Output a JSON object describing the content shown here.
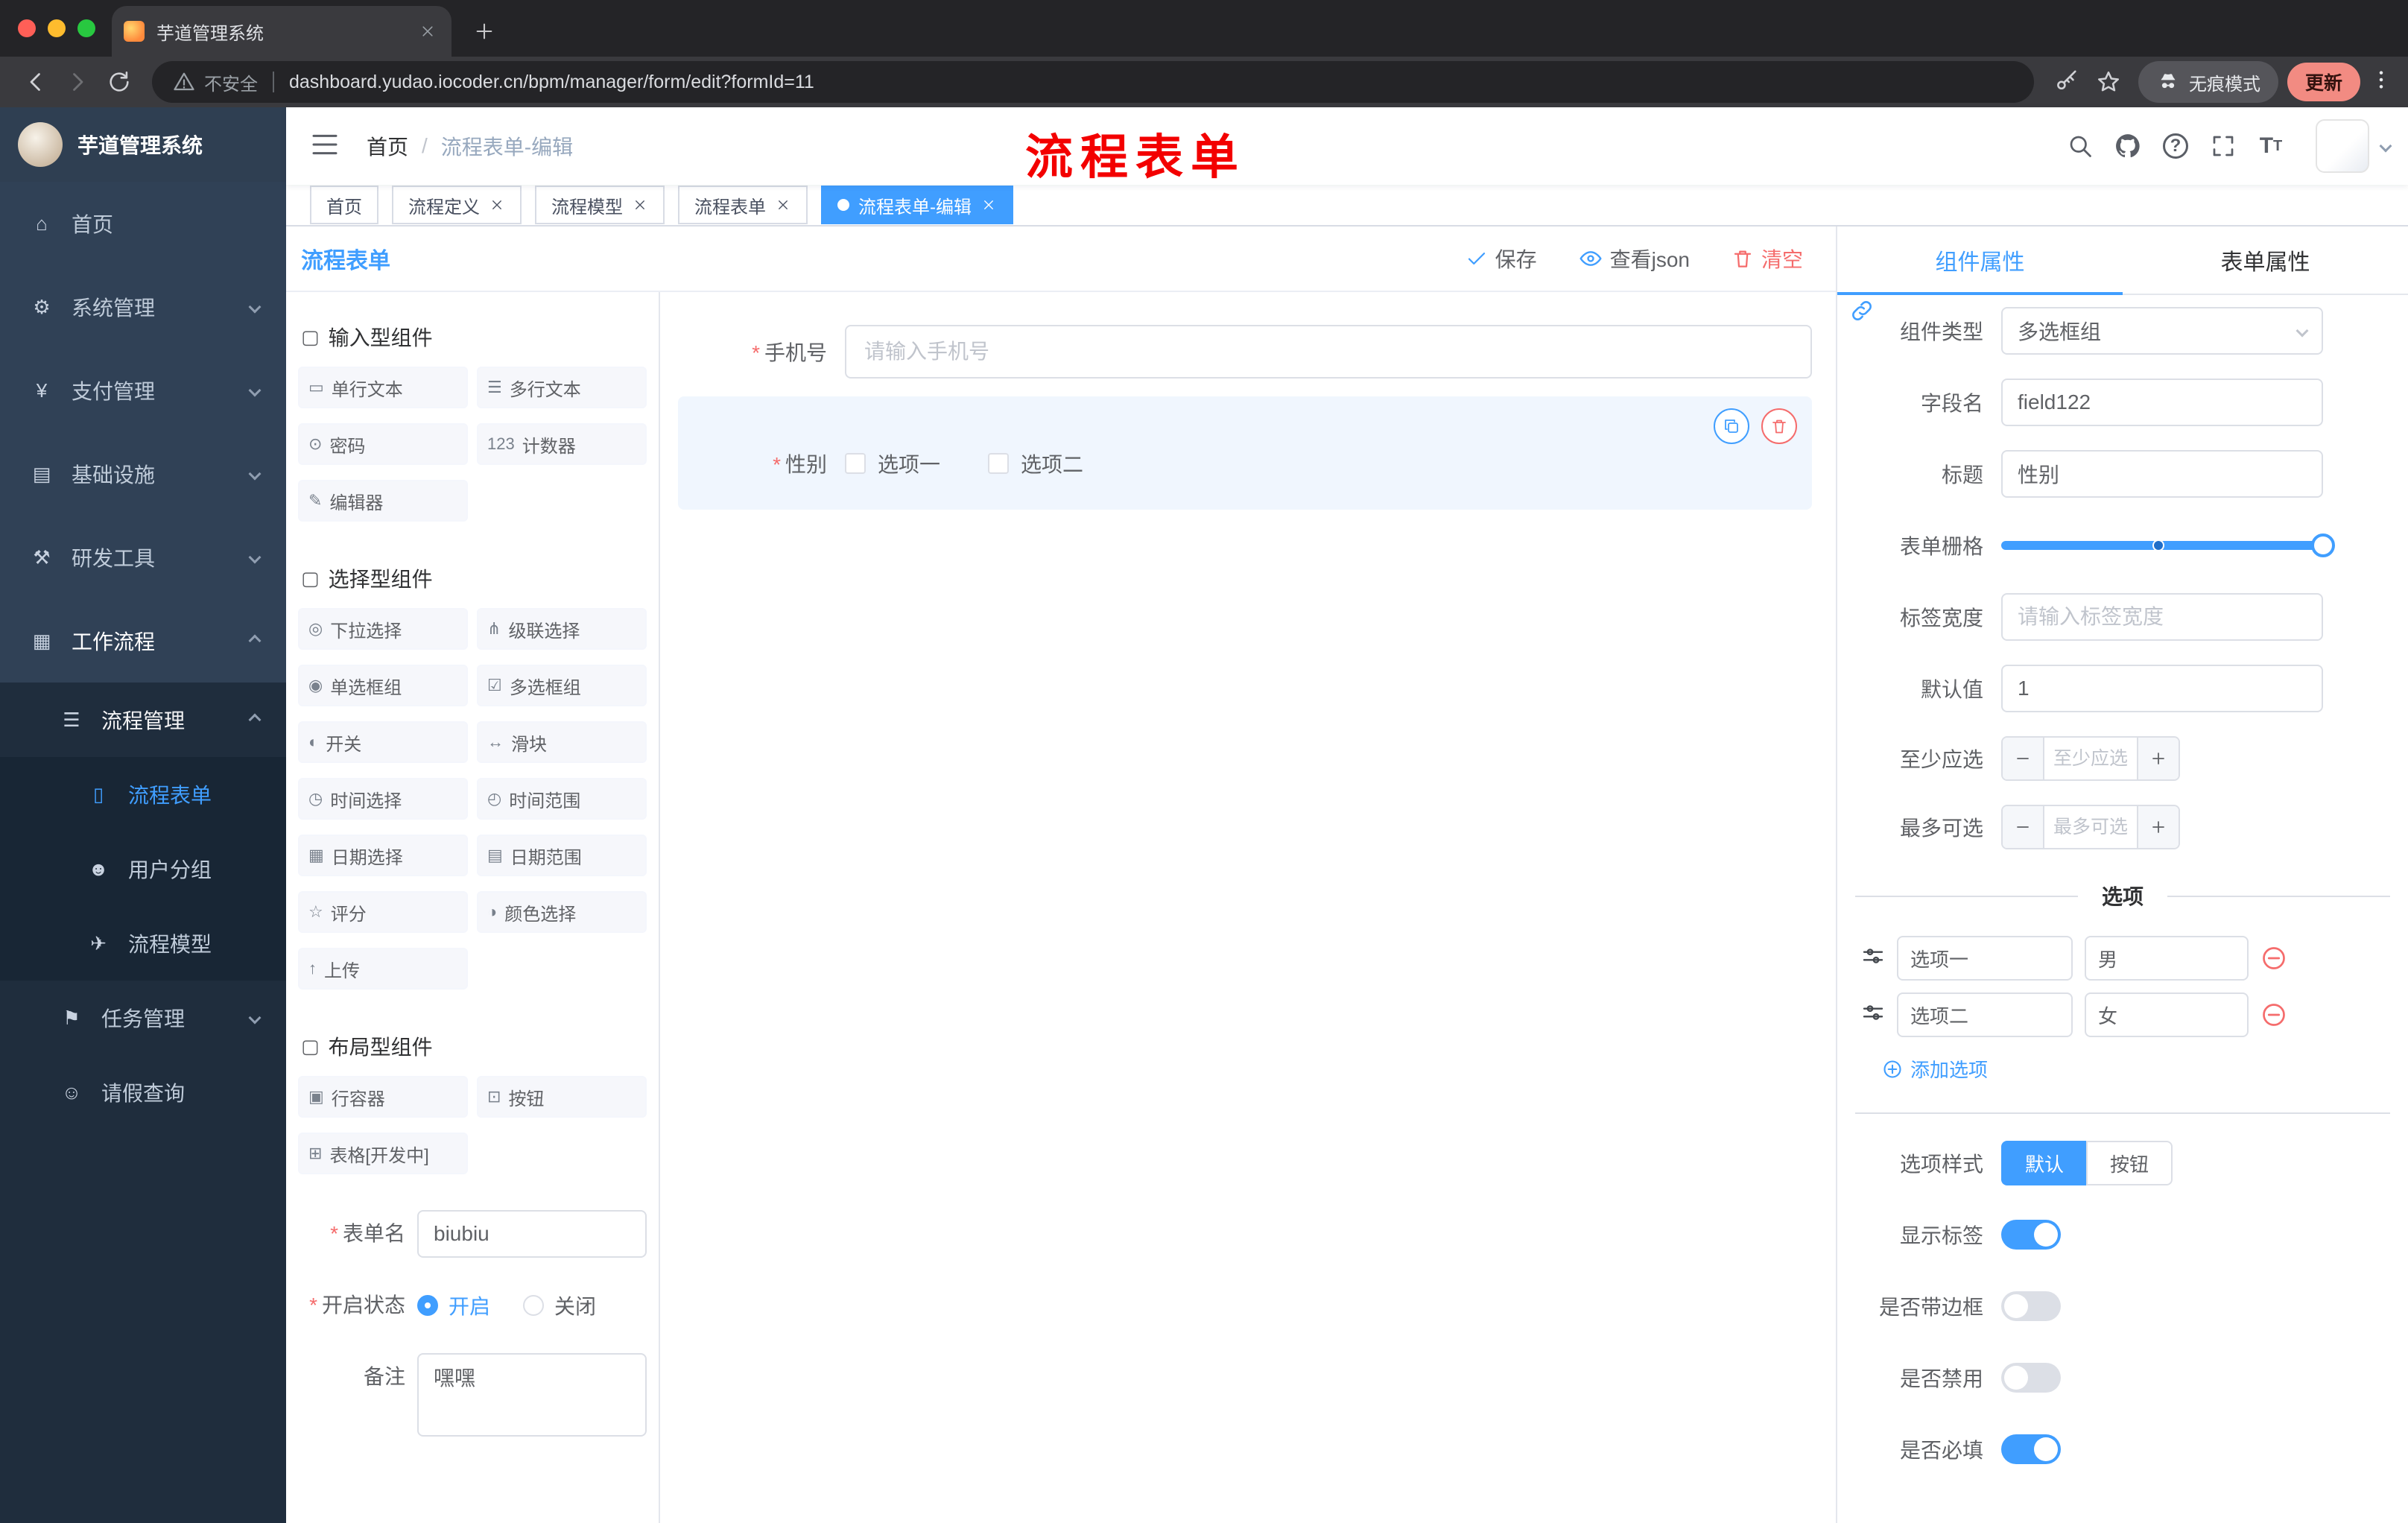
{
  "browser": {
    "tab_title": "芋道管理系统",
    "security": "不安全",
    "url": "dashboard.yudao.iocoder.cn/bpm/manager/form/edit?formId=11",
    "incognito": "无痕模式",
    "update": "更新"
  },
  "sidebar": {
    "logo": "芋道管理系统",
    "items": [
      {
        "label": "首页",
        "glyph": "⌂"
      },
      {
        "label": "系统管理",
        "glyph": "⚙"
      },
      {
        "label": "支付管理",
        "glyph": "¥"
      },
      {
        "label": "基础设施",
        "glyph": "▤"
      },
      {
        "label": "研发工具",
        "glyph": "⚒"
      },
      {
        "label": "工作流程",
        "glyph": "▦"
      },
      {
        "label": "流程管理",
        "glyph": "☰"
      },
      {
        "label": "流程表单",
        "glyph": "▯"
      },
      {
        "label": "用户分组",
        "glyph": "☻"
      },
      {
        "label": "流程模型",
        "glyph": "✈"
      },
      {
        "label": "任务管理",
        "glyph": "⚑"
      },
      {
        "label": "请假查询",
        "glyph": "☺"
      }
    ]
  },
  "header": {
    "breadcrumb_home": "首页",
    "breadcrumb_current": "流程表单-编辑",
    "annotation": "流程表单"
  },
  "tags": [
    {
      "label": "首页"
    },
    {
      "label": "流程定义"
    },
    {
      "label": "流程模型"
    },
    {
      "label": "流程表单"
    },
    {
      "label": "流程表单-编辑"
    }
  ],
  "designer": {
    "title": "流程表单",
    "actions": {
      "save": "保存",
      "view_json": "查看json",
      "clear": "清空"
    },
    "groups": [
      {
        "title": "输入型组件",
        "glyph": "▢",
        "items": [
          {
            "label": "单行文本",
            "glyph": "▭"
          },
          {
            "label": "多行文本",
            "glyph": "☰"
          },
          {
            "label": "密码",
            "glyph": "⊙"
          },
          {
            "label": "计数器",
            "glyph": "123"
          },
          {
            "label": "编辑器",
            "glyph": "✎"
          }
        ]
      },
      {
        "title": "选择型组件",
        "glyph": "▢",
        "items": [
          {
            "label": "下拉选择",
            "glyph": "◎"
          },
          {
            "label": "级联选择",
            "glyph": "⋔"
          },
          {
            "label": "单选框组",
            "glyph": "◉"
          },
          {
            "label": "多选框组",
            "glyph": "☑"
          },
          {
            "label": "开关",
            "glyph": "◐"
          },
          {
            "label": "滑块",
            "glyph": "↔"
          },
          {
            "label": "时间选择",
            "glyph": "◷"
          },
          {
            "label": "时间范围",
            "glyph": "◴"
          },
          {
            "label": "日期选择",
            "glyph": "▦"
          },
          {
            "label": "日期范围",
            "glyph": "▤"
          },
          {
            "label": "评分",
            "glyph": "☆"
          },
          {
            "label": "颜色选择",
            "glyph": "◑"
          },
          {
            "label": "上传",
            "glyph": "↑"
          }
        ]
      },
      {
        "title": "布局型组件",
        "glyph": "▢",
        "items": [
          {
            "label": "行容器",
            "glyph": "▣"
          },
          {
            "label": "按钮",
            "glyph": "⊡"
          },
          {
            "label": "表格[开发中]",
            "glyph": "⊞"
          }
        ]
      }
    ],
    "meta": {
      "name_label": "表单名",
      "name_value": "biubiu",
      "status_label": "开启状态",
      "status_on": "开启",
      "status_off": "关闭",
      "remark_label": "备注",
      "remark_value": "嘿嘿"
    },
    "canvas": {
      "phone_label": "手机号",
      "phone_placeholder": "请输入手机号",
      "gender_label": "性别",
      "gender_opt1": "选项一",
      "gender_opt2": "选项二"
    }
  },
  "props": {
    "tab_component": "组件属性",
    "tab_form": "表单属性",
    "type_label": "组件类型",
    "type_value": "多选框组",
    "field_label": "字段名",
    "field_value": "field122",
    "title_label": "标题",
    "title_value": "性别",
    "grid_label": "表单栅格",
    "width_label": "标签宽度",
    "width_placeholder": "请输入标签宽度",
    "default_label": "默认值",
    "default_value": "1",
    "min_label": "至少应选",
    "min_placeholder": "至少应选",
    "max_label": "最多可选",
    "max_placeholder": "最多可选",
    "options_title": "选项",
    "option_rows": [
      {
        "label": "选项一",
        "value": "男"
      },
      {
        "label": "选项二",
        "value": "女"
      }
    ],
    "add_option": "添加选项",
    "style_label": "选项样式",
    "style_default": "默认",
    "style_button": "按钮",
    "show_label_label": "显示标签",
    "border_label": "是否带边框",
    "disabled_label": "是否禁用",
    "required_label": "是否必填"
  },
  "colors": {
    "accent": "#409eff",
    "danger": "#f56c6c"
  }
}
